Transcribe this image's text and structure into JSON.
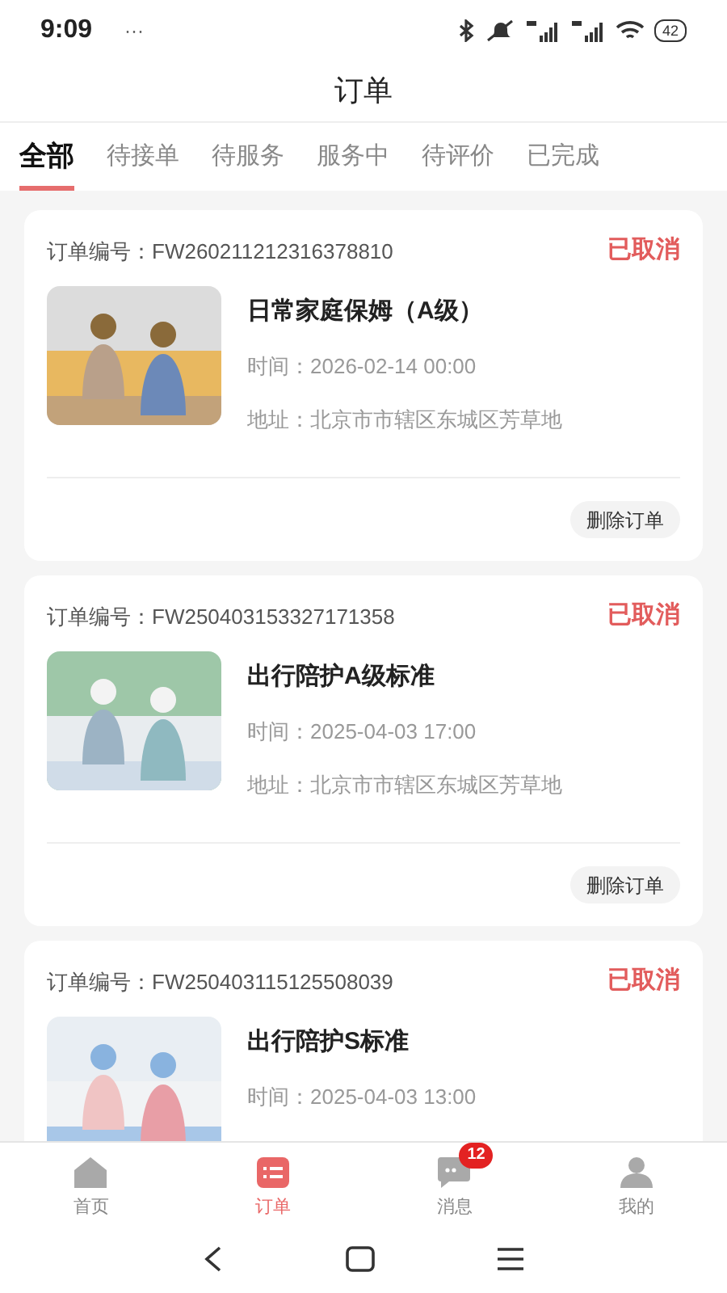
{
  "status_bar": {
    "time": "9:09",
    "dots": "···",
    "battery": "42"
  },
  "title": "订单",
  "tabs": [
    {
      "label": "全部",
      "selected": true
    },
    {
      "label": "待接单",
      "selected": false
    },
    {
      "label": "待服务",
      "selected": false
    },
    {
      "label": "服务中",
      "selected": false
    },
    {
      "label": "待评价",
      "selected": false
    },
    {
      "label": "已完成",
      "selected": false
    }
  ],
  "orders": [
    {
      "order_no": "订单编号：FW260211212316378810",
      "status": "已取消",
      "service": "日常家庭保姆（A级）",
      "time": "时间：2026-02-14 00:00",
      "address": "地址：北京市市辖区东城区芳草地",
      "action": "删除订单"
    },
    {
      "order_no": "订单编号：FW250403153327171358",
      "status": "已取消",
      "service": "出行陪护A级标准",
      "time": "时间：2025-04-03 17:00",
      "address": "地址：北京市市辖区东城区芳草地",
      "action": "删除订单"
    },
    {
      "order_no": "订单编号：FW250403115125508039",
      "status": "已取消",
      "service": "出行陪护S标准",
      "time": "时间：2025-04-03 13:00"
    }
  ],
  "bottom_nav": [
    {
      "label": "首页",
      "kind": "home",
      "selected": false
    },
    {
      "label": "订单",
      "kind": "orders",
      "selected": true
    },
    {
      "label": "消息",
      "kind": "messages",
      "selected": false,
      "badge": "12"
    },
    {
      "label": "我的",
      "kind": "profile",
      "selected": false
    }
  ]
}
